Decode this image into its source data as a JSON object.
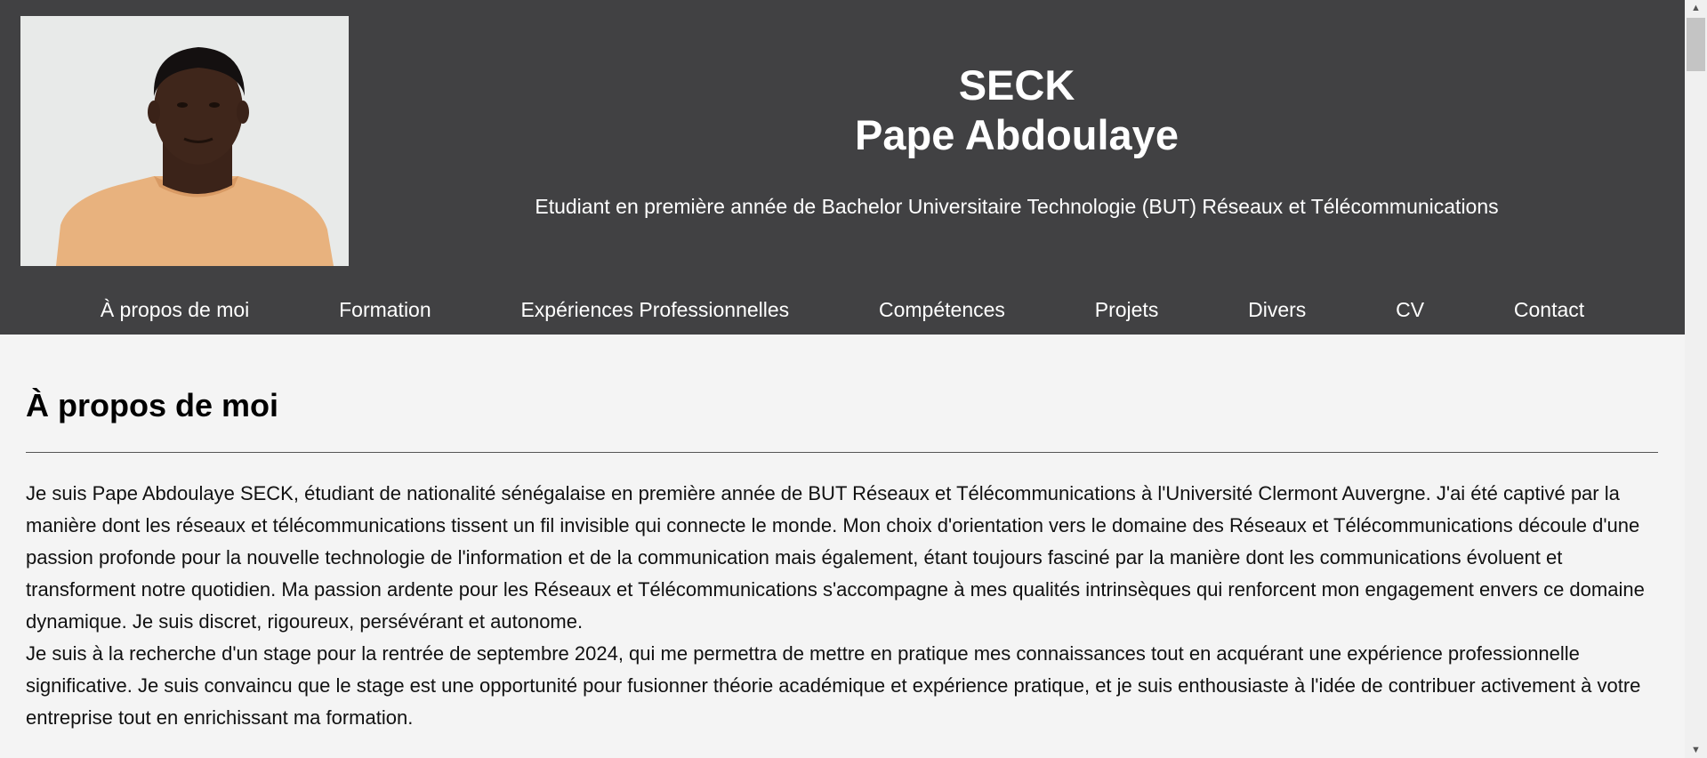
{
  "header": {
    "photo_alt": "Portrait photo",
    "last_name": "SECK",
    "first_name": "Pape Abdoulaye",
    "subtitle": "Etudiant en première année de Bachelor Universitaire Technologie (BUT) Réseaux et Télécommunications"
  },
  "nav": {
    "items": [
      {
        "label": "À propos de moi"
      },
      {
        "label": "Formation"
      },
      {
        "label": "Expériences Professionnelles"
      },
      {
        "label": "Compétences"
      },
      {
        "label": "Projets"
      },
      {
        "label": "Divers"
      },
      {
        "label": "CV"
      },
      {
        "label": "Contact"
      }
    ]
  },
  "about": {
    "heading": "À propos de moi",
    "paragraph1": "Je suis Pape Abdoulaye SECK, étudiant de nationalité sénégalaise en première année de BUT Réseaux et Télécommunications à l'Université Clermont Auvergne. J'ai été captivé par la manière dont les réseaux et télécommunications tissent un fil invisible qui connecte le monde. Mon choix d'orientation vers le domaine des Réseaux et Télécommunications découle d'une passion profonde pour la nouvelle technologie de l'information et de la communication mais également, étant toujours fasciné par la manière dont les communications évoluent et transforment notre quotidien. Ma passion ardente pour les Réseaux et Télécommunications s'accompagne à mes qualités intrinsèques qui renforcent mon engagement envers ce domaine dynamique. Je suis discret, rigoureux, persévérant et autonome.",
    "paragraph2": "Je suis à la recherche d'un stage pour la rentrée de septembre 2024, qui me permettra de mettre en pratique mes connaissances tout en acquérant une expérience professionnelle significative. Je suis convaincu que le stage est une opportunité pour fusionner théorie académique et expérience pratique, et je suis enthousiaste à l'idée de contribuer activement à votre entreprise tout en enrichissant ma formation."
  },
  "colors": {
    "header_bg": "#414143",
    "page_bg": "#f4f4f4",
    "text": "#111111",
    "nav_text": "#ffffff"
  },
  "icons": {
    "scroll_up": "scroll-up-arrow-icon",
    "scroll_down": "scroll-down-arrow-icon"
  }
}
